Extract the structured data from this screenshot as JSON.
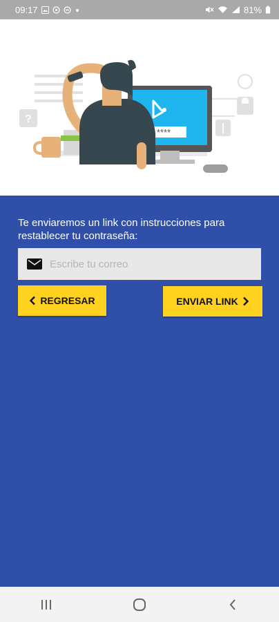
{
  "status_bar": {
    "time": "09:17",
    "left_icons": [
      "gallery-icon",
      "whatsapp-icon",
      "do-not-disturb-icon",
      "dot-icon"
    ],
    "right_icons": [
      "mute-icon",
      "wifi-icon",
      "signal-icon"
    ],
    "battery": "81%"
  },
  "hero": {
    "illustration": "person-at-computer-password-illustration",
    "password_mask": "****"
  },
  "form": {
    "instructions": "Te enviaremos un link con instrucciones para restablecer tu contraseña:",
    "email_placeholder": "Escribe tu correo",
    "email_value": "",
    "back_label": "REGRESAR",
    "send_label": "ENVIAR LINK"
  },
  "colors": {
    "panel": "#2f4fa8",
    "button": "#ffd21f",
    "input_bg": "#e8e8e8",
    "status_bar": "#a9a9a9"
  },
  "nav_bar": {
    "buttons": [
      "recent-apps-icon",
      "home-icon",
      "back-icon"
    ]
  }
}
